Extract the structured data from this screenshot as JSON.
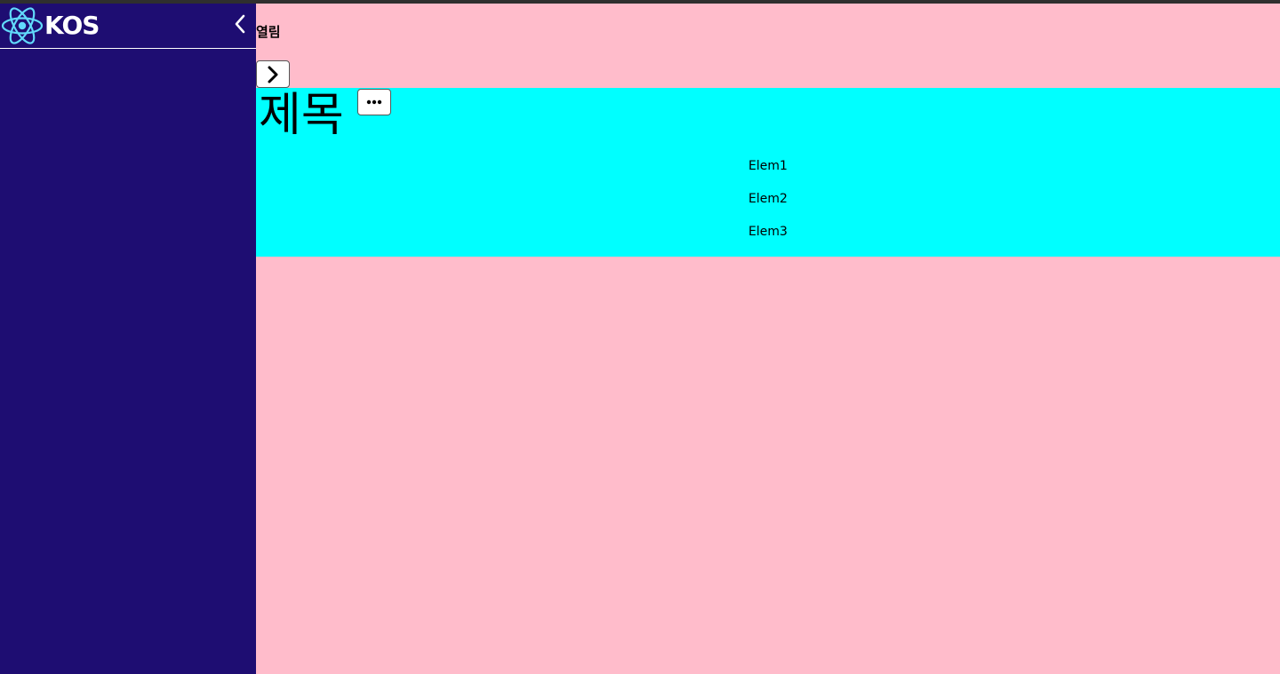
{
  "sidebar": {
    "brand": "KOS",
    "logo_icon": "react-atom-icon",
    "collapse_icon": "chevron-left-icon",
    "background": "#1e0d72"
  },
  "main": {
    "open_label": "열림",
    "expand_icon": "chevron-right-icon",
    "background": "#ffbccb"
  },
  "panel": {
    "title": "제목",
    "more_icon": "more-horizontal-icon",
    "background": "#00ffff",
    "items": [
      "Elem1",
      "Elem2",
      "Elem3"
    ]
  }
}
